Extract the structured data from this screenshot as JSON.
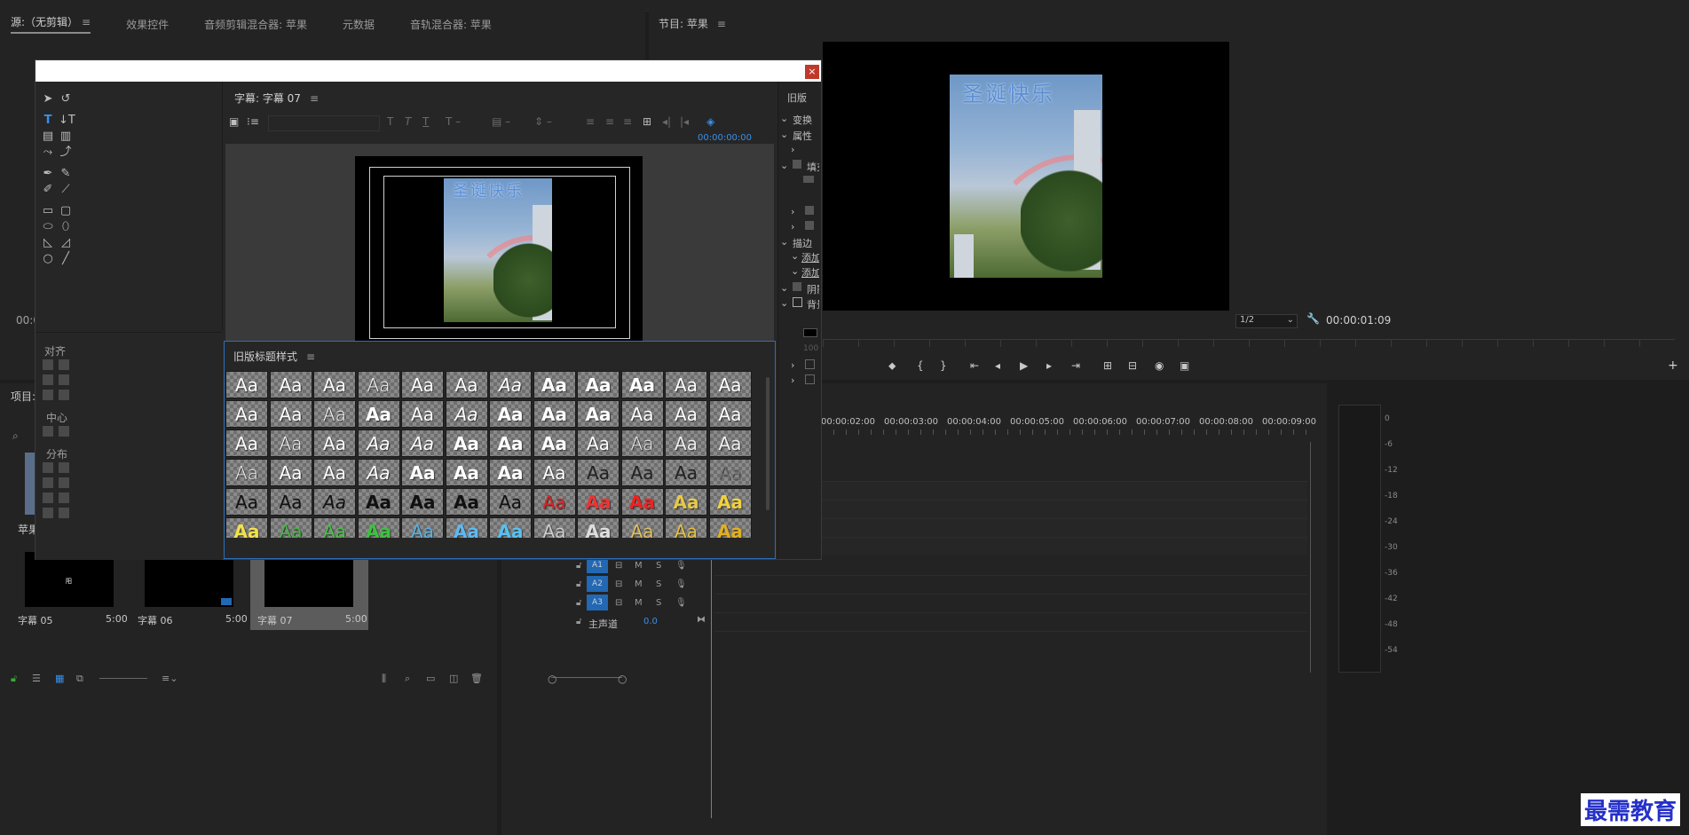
{
  "source_panel": {
    "tabs": [
      "源:（无剪辑）",
      "效果控件",
      "音频剪辑混合器: 苹果",
      "元数据",
      "音轨混合器: 苹果"
    ],
    "timecode_left": "00:0"
  },
  "program_panel": {
    "title": "节目: 苹果",
    "overlay_text": "圣诞快乐",
    "zoom": "1/2",
    "timecode": "00:00:01:09"
  },
  "dialog": {
    "close": "×",
    "editor_title": "字幕: 字幕 07",
    "editor_timecode": "00:00:00:00",
    "overlay_text": "圣诞快乐",
    "styles_title": "旧版标题样式",
    "align_label": "对齐",
    "center_label": "中心",
    "distribute_label": "分布",
    "props": {
      "header": "旧版",
      "transform": "变换",
      "attributes": "属性",
      "fill": "填充",
      "stroke": "描边",
      "add1": "添加",
      "add2": "添加",
      "shadow": "阴影",
      "background": "背景",
      "num100": "100"
    },
    "swatch_text": "Aa"
  },
  "project_panel": {
    "title": "项目:",
    "item_label": "苹果",
    "items": [
      {
        "name": "字幕 05",
        "duration": "5:00"
      },
      {
        "name": "字幕 06",
        "duration": "5:00"
      },
      {
        "name": "字幕 07",
        "duration": "5:00"
      }
    ]
  },
  "timeline": {
    "ruler": [
      "00:00:02:00",
      "00:00:03:00",
      "00:00:04:00",
      "00:00:05:00",
      "00:00:06:00",
      "00:00:07:00",
      "00:00:08:00",
      "00:00:09:00"
    ],
    "tracks": [
      "A1",
      "A2",
      "A3"
    ],
    "track_m": "M",
    "track_s": "S",
    "master_label": "主声道",
    "master_value": "0.0"
  },
  "meter": {
    "labels": [
      "0",
      "-6",
      "-12",
      "-18",
      "-24",
      "-30",
      "-36",
      "-42",
      "-48",
      "-54"
    ]
  },
  "watermark": "最需教育"
}
